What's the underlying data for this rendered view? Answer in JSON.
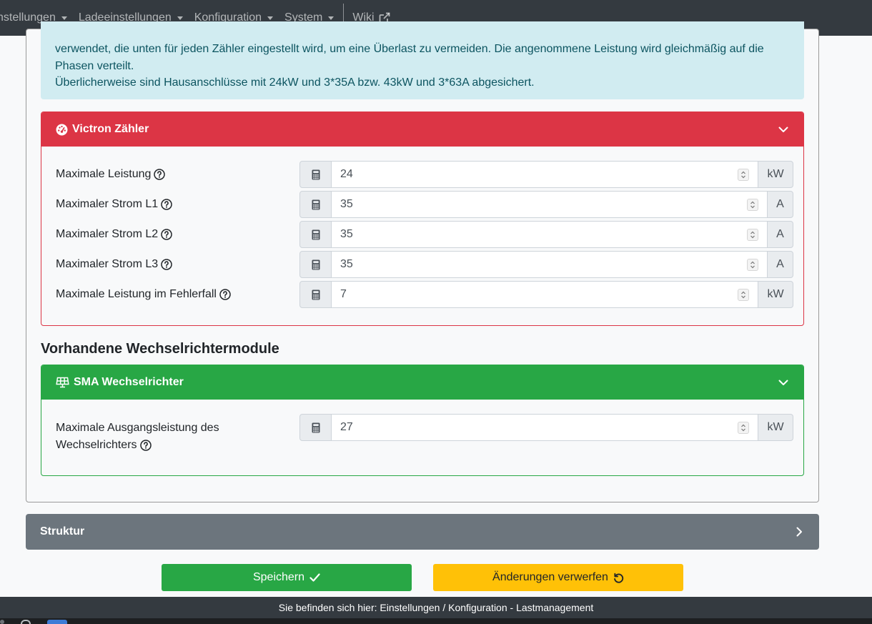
{
  "navbar": {
    "items": [
      {
        "label": "nstellungen"
      },
      {
        "label": "Ladeeinstellungen"
      },
      {
        "label": "Konfiguration"
      },
      {
        "label": "System"
      }
    ],
    "wiki_label": "Wiki"
  },
  "info_alert": {
    "line1": "verwendet, die unten für jeden Zähler eingestellt wird, um eine Überlast zu vermeiden. Die angenommene Leistung wird gleichmäßig auf die",
    "line2": "Phasen verteilt.",
    "line3": "Überlicherweise sind Hausanschlüsse mit 24kW und 3*35A bzw. 43kW und 3*63A abgesichert."
  },
  "victron_card": {
    "title": "Victron Zähler",
    "header_color": "#dc3545",
    "fields": [
      {
        "label": "Maximale Leistung",
        "value": "24",
        "unit": "kW"
      },
      {
        "label": "Maximaler Strom L1",
        "value": "35",
        "unit": "A"
      },
      {
        "label": "Maximaler Strom L2",
        "value": "35",
        "unit": "A"
      },
      {
        "label": "Maximaler Strom L3",
        "value": "35",
        "unit": "A"
      },
      {
        "label": "Maximale Leistung im Fehlerfall",
        "value": "7",
        "unit": "kW"
      }
    ]
  },
  "inverter_section": {
    "title": "Vorhandene Wechselrichtermodule"
  },
  "sma_card": {
    "title": "SMA Wechselrichter",
    "header_color": "#28a745",
    "field": {
      "label_line1": "Maximale Ausgangsleistung des",
      "label_line2": "Wechselrichters",
      "value": "27",
      "unit": "kW"
    }
  },
  "struktur_card": {
    "title": "Struktur",
    "color": "#6c757d"
  },
  "buttons": {
    "save_label": "Speichern",
    "discard_label": "Änderungen verwerfen",
    "save_color": "#28a745",
    "discard_color": "#ffc107"
  },
  "footer": {
    "text": "Sie befinden sich hier: Einstellungen / Konfiguration - Lastmanagement"
  },
  "icons": {
    "victron": "tachometer-icon",
    "sma": "solar-panel-icon",
    "field": "calculator-icon",
    "help": "question-circle-icon",
    "collapse": "chevron-down-icon",
    "expand": "chevron-right-icon",
    "save": "check-icon",
    "discard": "undo-icon",
    "external": "external-link-icon"
  }
}
